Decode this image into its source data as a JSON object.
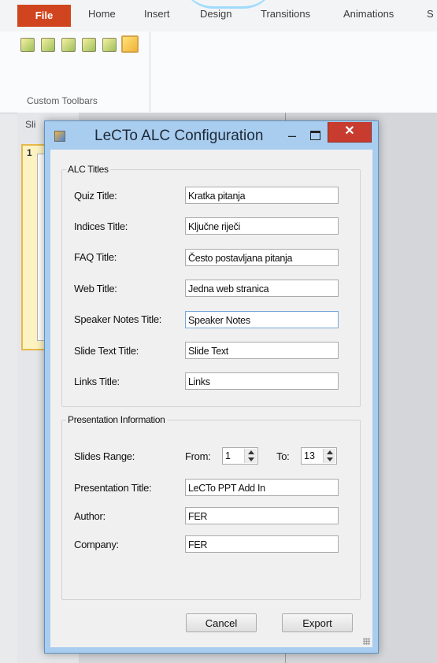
{
  "ribbon": {
    "tabs": [
      "File",
      "Home",
      "Insert",
      "Design",
      "Transitions",
      "Animations",
      "S"
    ],
    "group_label": "Custom Toolbars",
    "icons": [
      "toolbar-icon-1",
      "toolbar-icon-2",
      "toolbar-icon-3",
      "toolbar-icon-4",
      "toolbar-icon-5",
      "toolbar-icon-6"
    ]
  },
  "pane": {
    "tab_label": "Sli",
    "slide_number": "1"
  },
  "dialog": {
    "title": "LeCTo ALC Configuration",
    "controls": {
      "minimize": "–",
      "close": "✕"
    },
    "alc": {
      "legend": "ALC Titles",
      "rows": [
        {
          "label": "Quiz Title:",
          "value": "Kratka pitanja"
        },
        {
          "label": "Indices Title:",
          "value": "Ključne riječi"
        },
        {
          "label": "FAQ Title:",
          "value": "Često postavljana pitanja"
        },
        {
          "label": "Web Title:",
          "value": "Jedna web stranica"
        },
        {
          "label": "Speaker Notes Title:",
          "value": "Speaker Notes"
        },
        {
          "label": "Slide Text Title:",
          "value": "Slide Text"
        },
        {
          "label": "Links Title:",
          "value": "Links"
        }
      ]
    },
    "presentation": {
      "legend": "Presentation Information",
      "slides_range_label": "Slides Range:",
      "from_label": "From:",
      "from_value": "1",
      "to_label": "To:",
      "to_value": "13",
      "title_label": "Presentation Title:",
      "title_value": "LeCTo PPT Add In",
      "author_label": "Author:",
      "author_value": "FER",
      "company_label": "Company:",
      "company_value": "FER"
    },
    "buttons": {
      "cancel": "Cancel",
      "export": "Export"
    }
  },
  "colors": {
    "file_tab": "#d0451f",
    "close_button": "#c83c2f",
    "dialog_frame": "#a9cdef"
  }
}
